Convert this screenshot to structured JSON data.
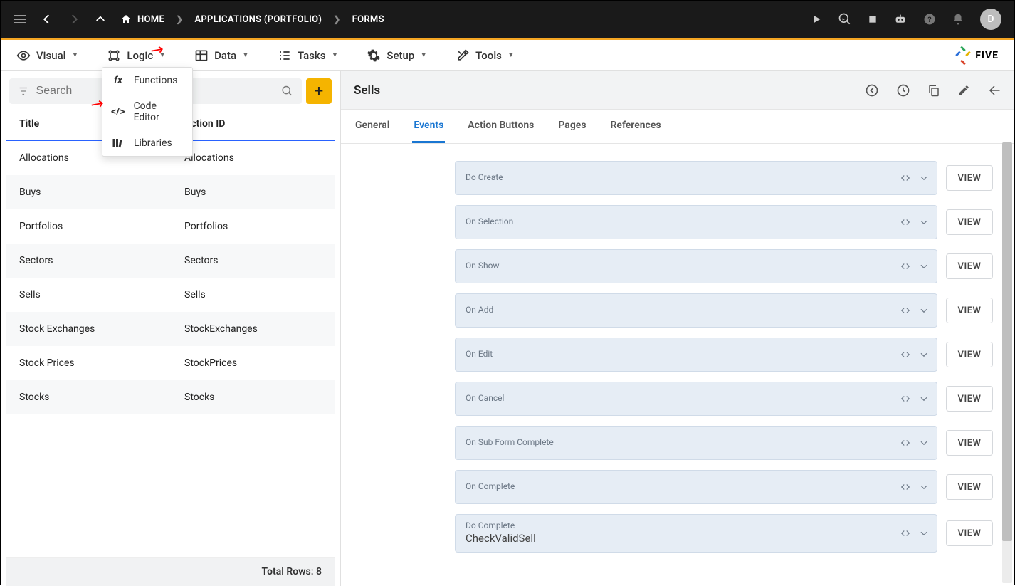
{
  "breadcrumb": {
    "home": "HOME",
    "apps": "APPLICATIONS (PORTFOLIO)",
    "forms": "FORMS"
  },
  "avatar_letter": "D",
  "toolbar": {
    "visual": "Visual",
    "logic": "Logic",
    "data": "Data",
    "tasks": "Tasks",
    "setup": "Setup",
    "tools": "Tools",
    "brand": "FIVE"
  },
  "logic_dropdown": {
    "functions": "Functions",
    "code_editor": "Code Editor",
    "libraries": "Libraries"
  },
  "search": {
    "placeholder": "Search"
  },
  "list": {
    "header_title": "Title",
    "header_action": "Action ID",
    "rows": [
      {
        "title": "Allocations",
        "action": "Allocations"
      },
      {
        "title": "Buys",
        "action": "Buys"
      },
      {
        "title": "Portfolios",
        "action": "Portfolios"
      },
      {
        "title": "Sectors",
        "action": "Sectors"
      },
      {
        "title": "Sells",
        "action": "Sells"
      },
      {
        "title": "Stock Exchanges",
        "action": "StockExchanges"
      },
      {
        "title": "Stock Prices",
        "action": "StockPrices"
      },
      {
        "title": "Stocks",
        "action": "Stocks"
      }
    ],
    "footer": "Total Rows: 8"
  },
  "right": {
    "title": "Sells",
    "tabs": {
      "general": "General",
      "events": "Events",
      "action_buttons": "Action Buttons",
      "pages": "Pages",
      "references": "References"
    },
    "view_label": "VIEW",
    "events": [
      {
        "label": "Do Create",
        "value": ""
      },
      {
        "label": "On Selection",
        "value": ""
      },
      {
        "label": "On Show",
        "value": ""
      },
      {
        "label": "On Add",
        "value": ""
      },
      {
        "label": "On Edit",
        "value": ""
      },
      {
        "label": "On Cancel",
        "value": ""
      },
      {
        "label": "On Sub Form Complete",
        "value": ""
      },
      {
        "label": "On Complete",
        "value": ""
      },
      {
        "label": "Do Complete",
        "value": "CheckValidSell"
      }
    ]
  }
}
